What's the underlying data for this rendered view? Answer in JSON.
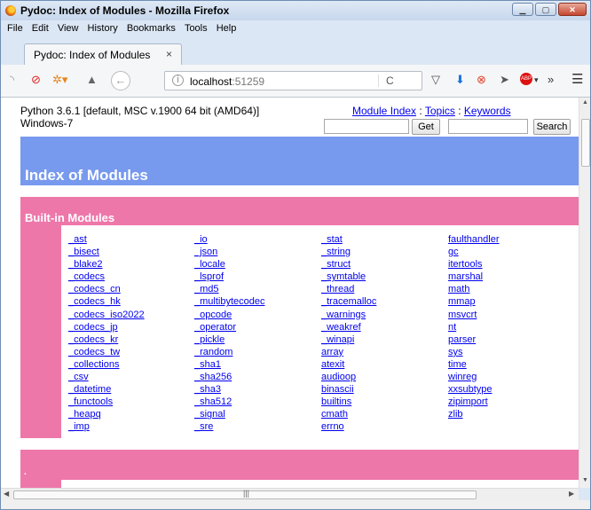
{
  "window": {
    "title": "Pydoc: Index of Modules - Mozilla Firefox"
  },
  "menu": [
    "File",
    "Edit",
    "View",
    "History",
    "Bookmarks",
    "Tools",
    "Help"
  ],
  "tab": {
    "label": "Pydoc: Index of Modules",
    "close": "×"
  },
  "nav": {
    "url_host": "localhost",
    "url_port": ":51259",
    "icons": [
      "rss-icon",
      "stop-icon",
      "firebug-icon",
      "extension-icon",
      "back-icon",
      "info-icon",
      "reload-icon",
      "pocket-icon",
      "download-icon",
      "blocked-icon",
      "send-icon",
      "adblock-icon",
      "overflow-icon",
      "menu-icon"
    ]
  },
  "page": {
    "python_version": "Python 3.6.1 [default, MSC v.1900 64 bit (AMD64)]",
    "os": "Windows-7",
    "links": {
      "module_index": "Module Index",
      "topics": "Topics",
      "keywords": "Keywords"
    },
    "get_button": "Get",
    "search_button": "Search",
    "heading": "Index of Modules",
    "builtin_heading": "Built-in Modules",
    "next_heading": "."
  },
  "modules": [
    [
      "_ast",
      "_bisect",
      "_blake2",
      "_codecs",
      "_codecs_cn",
      "_codecs_hk",
      "_codecs_iso2022",
      "_codecs_jp",
      "_codecs_kr",
      "_codecs_tw",
      "_collections",
      "_csv",
      "_datetime",
      "_functools",
      "_heapq",
      "_imp"
    ],
    [
      "_io",
      "_json",
      "_locale",
      "_lsprof",
      "_md5",
      "_multibytecodec",
      "_opcode",
      "_operator",
      "_pickle",
      "_random",
      "_sha1",
      "_sha256",
      "_sha3",
      "_sha512",
      "_signal",
      "_sre"
    ],
    [
      "_stat",
      "_string",
      "_struct",
      "_symtable",
      "_thread",
      "_tracemalloc",
      "_warnings",
      "_weakref",
      "_winapi",
      "array",
      "atexit",
      "audioop",
      "binascii",
      "builtins",
      "cmath",
      "errno"
    ],
    [
      "faulthandler",
      "gc",
      "itertools",
      "marshal",
      "math",
      "mmap",
      "msvcrt",
      "nt",
      "parser",
      "sys",
      "time",
      "winreg",
      "xxsubtype",
      "zipimport",
      "zlib"
    ]
  ]
}
